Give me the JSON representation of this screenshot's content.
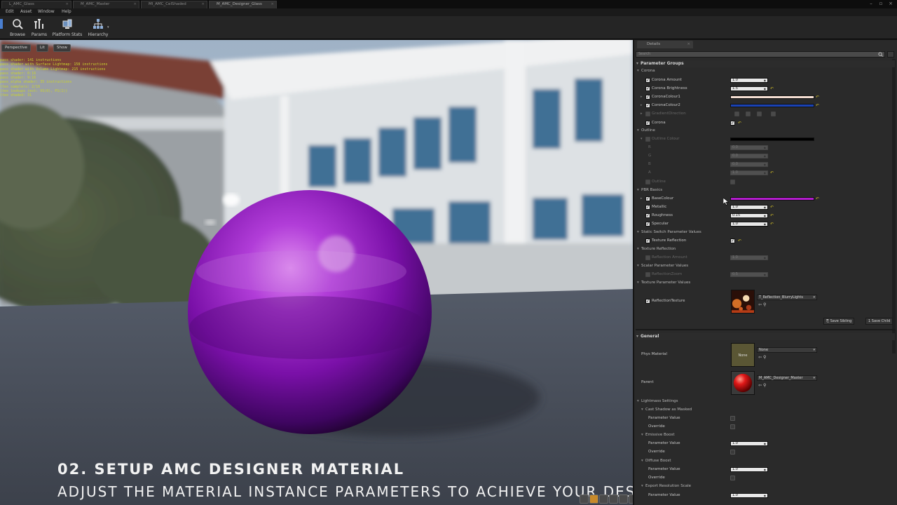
{
  "tabs": [
    {
      "label": "L_AMC_Glass",
      "active": false
    },
    {
      "label": "M_AMC_Master",
      "active": false
    },
    {
      "label": "MI_AMC_CelShaded",
      "active": false
    },
    {
      "label": "M_AMC_Designer_Glass",
      "active": true
    }
  ],
  "menu": [
    "Edit",
    "Asset",
    "Window",
    "Help"
  ],
  "toolbar": {
    "items": [
      {
        "label": "Browse",
        "icon": "magnifier-icon"
      },
      {
        "label": "Params",
        "icon": "params-icon"
      },
      {
        "label": "Platform Stats",
        "icon": "platform-stats-icon"
      },
      {
        "label": "Hierarchy",
        "icon": "hierarchy-icon"
      }
    ]
  },
  "viewport": {
    "buttons": [
      "Perspective",
      "Lit",
      "Show"
    ],
    "stats": [
      "pass shader: 141 instructions",
      "pass shader with Surface Lightmap: 158 instructions",
      "pass shader with Volume Lightmap: 215 instructions",
      "pass shader: 0:16",
      "pass shader: 9:16",
      "pass_alpha shader: 35 instructions",
      "ltex samplers: 2/16",
      "ltex lookups (est: VS(0), PS(1))",
      "ltex shaded: 31"
    ],
    "caption_title": "02. SETUP AMC DESIGNER MATERIAL",
    "caption_subtitle": "ADJUST THE MATERIAL INSTANCE PARAMETERS TO ACHIEVE YOUR DESIRED LOOK"
  },
  "details": {
    "tab_label": "Details",
    "search_placeholder": "Search",
    "parameter_groups_header": "Parameter Groups",
    "corona_group": "Corona",
    "corona_amount_label": "Corona Amount",
    "corona_amount_value": "1.0",
    "corona_brightness_label": "Corona Brightness",
    "corona_brightness_value": "1.5",
    "corona_colour1_label": "CoronaColour1",
    "corona_colour1_color": "#f4ded2",
    "corona_colour2_label": "CoronaColour2",
    "corona_colour2_color": "#1a42b4",
    "gradient_direction_label": "GradientDirection",
    "corona_label": "Corona",
    "outline_group": "Outline",
    "outline_colour_label": "Outline Colour",
    "outline_colour_color": "#000000",
    "outline_r_label": "R",
    "outline_r_value": "0.0",
    "outline_g_label": "G",
    "outline_g_value": "0.0",
    "outline_b_label": "B",
    "outline_b_value": "0.0",
    "outline_a_label": "A",
    "outline_a_value": "1.0",
    "outline_label": "Outline",
    "pbr_group": "PBR Basics",
    "base_colour_label": "BaseColour",
    "base_colour_color": "#b21ccc",
    "metallic_label": "Metallic",
    "metallic_value": "1.0",
    "roughness_label": "Roughness",
    "roughness_value": "0.15",
    "specular_label": "Specular",
    "specular_value": "1.0",
    "static_switch_group": "Static Switch Parameter Values",
    "texture_reflection_label": "Texture Reflection",
    "texture_reflection_group": "Texture Reflection",
    "reflection_amount_label": "Reflection Amount",
    "reflection_amount_value": "1.0",
    "scalar_group": "Scalar Parameter Values",
    "reflection_zoom_label": "ReflectionZoom",
    "reflection_zoom_value": "0.5",
    "texture_param_group": "Texture Parameter Values",
    "reflection_texture_label": "ReflectionTexture",
    "reflection_texture_asset": "T_Reflection_BlurryLights",
    "save_sibling_label": "Save Sibling",
    "save_child_label": "1 Save Child",
    "general_header": "General",
    "phys_material_label": "Phys Material",
    "phys_material_value": "None",
    "phys_material_thumb": "None",
    "parent_label": "Parent",
    "parent_value": "M_AMC_Designer_Master",
    "lightmass_group": "Lightmass Settings",
    "cast_shadow_group": "Cast Shadow as Masked",
    "parameter_value_label": "Parameter Value",
    "override_label": "Override",
    "emissive_boost_group": "Emissive Boost",
    "emissive_param_value": "1.0",
    "diffuse_boost_group": "Diffuse Boost",
    "diffuse_param_value": "1.0",
    "export_resolution_group": "Export Resolution Scale",
    "export_param_value": "1.0"
  }
}
